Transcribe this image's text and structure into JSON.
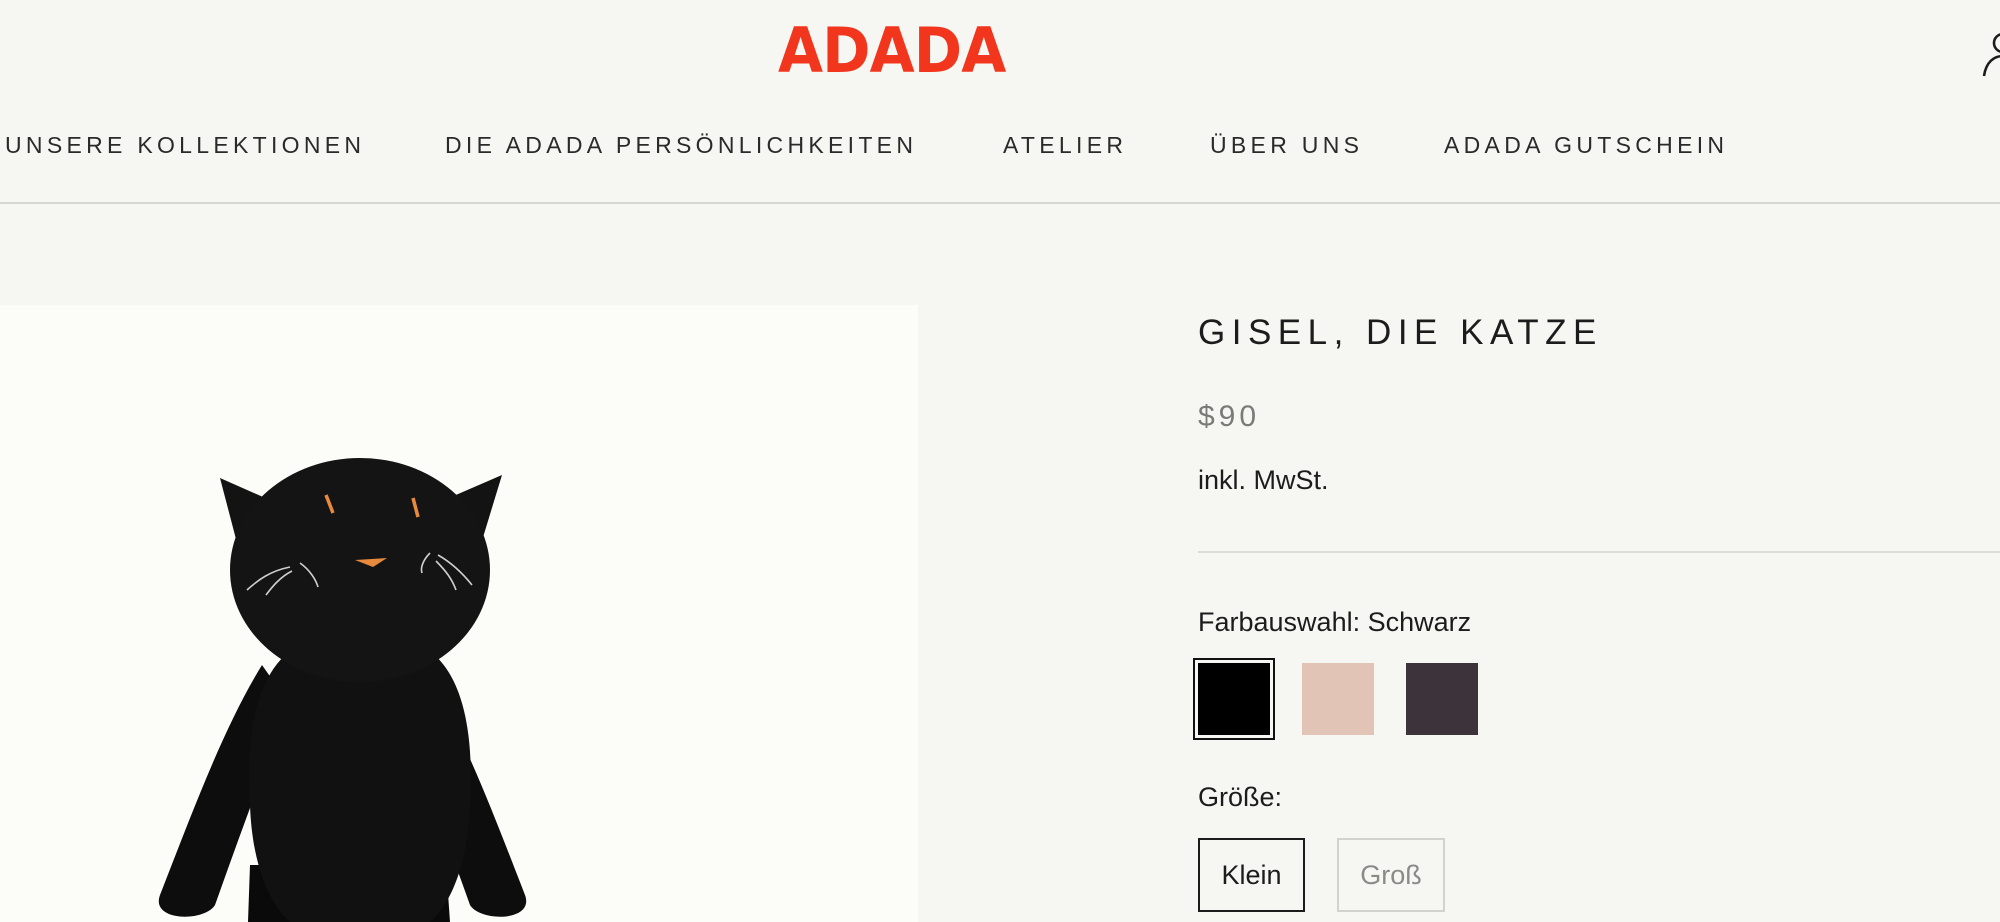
{
  "brand": {
    "logo_text": "ADADA",
    "logo_color": "#f2361e"
  },
  "header": {
    "account_icon": "user-icon"
  },
  "nav": {
    "items": [
      {
        "label": "UNSERE KOLLEKTIONEN"
      },
      {
        "label": "DIE ADADA PERSÖNLICHKEITEN"
      },
      {
        "label": "ATELIER"
      },
      {
        "label": "ÜBER UNS"
      },
      {
        "label": "ADADA GUTSCHEIN"
      }
    ]
  },
  "product": {
    "title": "GISEL, DIE KATZE",
    "price": "$90",
    "tax_note": "inkl. MwSt.",
    "image_subject": "black plush cat",
    "color_option_label": "Farbauswahl: Schwarz",
    "colors": [
      {
        "name": "Schwarz",
        "hex": "#000000",
        "selected": true
      },
      {
        "name": "Rosa",
        "hex": "#e2c4b7",
        "selected": false
      },
      {
        "name": "Aubergine",
        "hex": "#3d333a",
        "selected": false
      }
    ],
    "size_label": "Größe:",
    "sizes": [
      {
        "label": "Klein",
        "selected": true
      },
      {
        "label": "Groß",
        "selected": false
      }
    ]
  }
}
